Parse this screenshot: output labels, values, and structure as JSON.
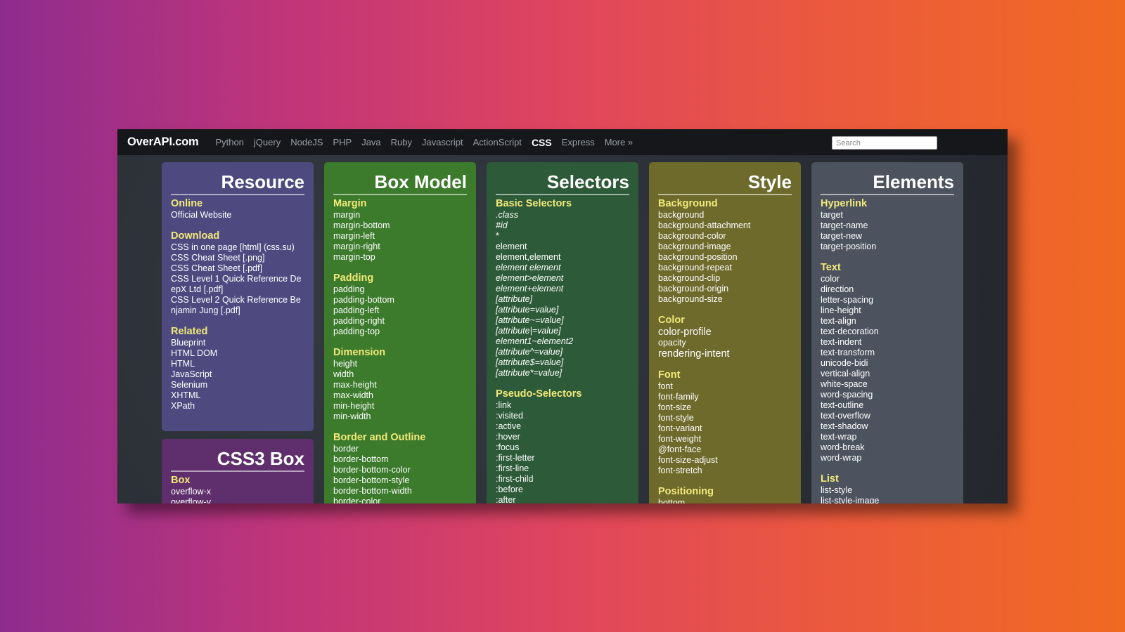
{
  "navbar": {
    "brand": "OverAPI.com",
    "links": [
      "Python",
      "jQuery",
      "NodeJS",
      "PHP",
      "Java",
      "Ruby",
      "Javascript",
      "ActionScript",
      "CSS",
      "Express",
      "More »"
    ],
    "active": "CSS",
    "search_placeholder": "Search"
  },
  "cards": {
    "resource": {
      "title": "Resource",
      "sections": [
        {
          "title": "Online",
          "items": [
            "Official Website"
          ]
        },
        {
          "title": "Download",
          "items": [
            "CSS in one page [html] (css.su)",
            "CSS Cheat Sheet [.png]",
            "CSS Cheat Sheet [.pdf]",
            "CSS Level 1 Quick Reference DeepX Ltd [.pdf]",
            "CSS Level 2 Quick Reference Benjamin Jung [.pdf]"
          ]
        },
        {
          "title": "Related",
          "items": [
            "Blueprint",
            "HTML DOM",
            "HTML",
            "JavaScript",
            "Selenium",
            "XHTML",
            "XPath"
          ]
        }
      ]
    },
    "css3": {
      "title": "CSS3 Box",
      "sections": [
        {
          "title": "Box",
          "items": [
            "overflow-x",
            "overflow-y"
          ]
        }
      ]
    },
    "boxmodel": {
      "title": "Box Model",
      "sections": [
        {
          "title": "Margin",
          "items": [
            "margin",
            "margin-bottom",
            "margin-left",
            "margin-right",
            "margin-top"
          ]
        },
        {
          "title": "Padding",
          "items": [
            "padding",
            "padding-bottom",
            "padding-left",
            "padding-right",
            "padding-top"
          ]
        },
        {
          "title": "Dimension",
          "items": [
            "height",
            "width",
            "max-height",
            "max-width",
            "min-height",
            "min-width"
          ]
        },
        {
          "title": "Border and Outline",
          "items": [
            "border",
            "border-bottom",
            "border-bottom-color",
            "border-bottom-style",
            "border-bottom-width",
            "border-color"
          ]
        }
      ]
    },
    "selectors": {
      "title": "Selectors",
      "sections": [
        {
          "title": "Basic Selectors",
          "items": [
            ".class",
            "#id",
            "*",
            "element",
            "element,element",
            "element element",
            "element>element",
            "element+element",
            "[attribute]",
            "[attribute=value]",
            "[attribute~=value]",
            "[attribute|=value]",
            "element1~element2",
            "[attribute^=value]",
            "[attribute$=value]",
            "[attribute*=value]"
          ]
        },
        {
          "title": "Pseudo-Selectors",
          "items": [
            ":link",
            ":visited",
            ":active",
            ":hover",
            ":focus",
            ":first-letter",
            ":first-line",
            ":first-child",
            ":before",
            ":after"
          ]
        }
      ]
    },
    "style": {
      "title": "Style",
      "sections": [
        {
          "title": "Background",
          "items": [
            "background",
            "background-attachment",
            "background-color",
            "background-image",
            "background-position",
            "background-repeat",
            "background-clip",
            "background-origin",
            "background-size"
          ]
        },
        {
          "title": "Color",
          "items": [
            "color-profile",
            "opacity",
            "rendering-intent"
          ]
        },
        {
          "title": "Font",
          "items": [
            "font",
            "font-family",
            "font-size",
            "font-style",
            "font-variant",
            "font-weight",
            "@font-face",
            "font-size-adjust",
            "font-stretch"
          ]
        },
        {
          "title": "Positioning",
          "items": [
            "bottom"
          ]
        }
      ]
    },
    "elements": {
      "title": "Elements",
      "sections": [
        {
          "title": "Hyperlink",
          "items": [
            "target",
            "target-name",
            "target-new",
            "target-position"
          ]
        },
        {
          "title": "Text",
          "items": [
            "color",
            "direction",
            "letter-spacing",
            "line-height",
            "text-align",
            "text-decoration",
            "text-indent",
            "text-transform",
            "unicode-bidi",
            "vertical-align",
            "white-space",
            "word-spacing",
            "text-outline",
            "text-overflow",
            "text-shadow",
            "text-wrap",
            "word-break",
            "word-wrap"
          ]
        },
        {
          "title": "List",
          "items": [
            "list-style",
            "list-style-image"
          ]
        }
      ]
    }
  }
}
